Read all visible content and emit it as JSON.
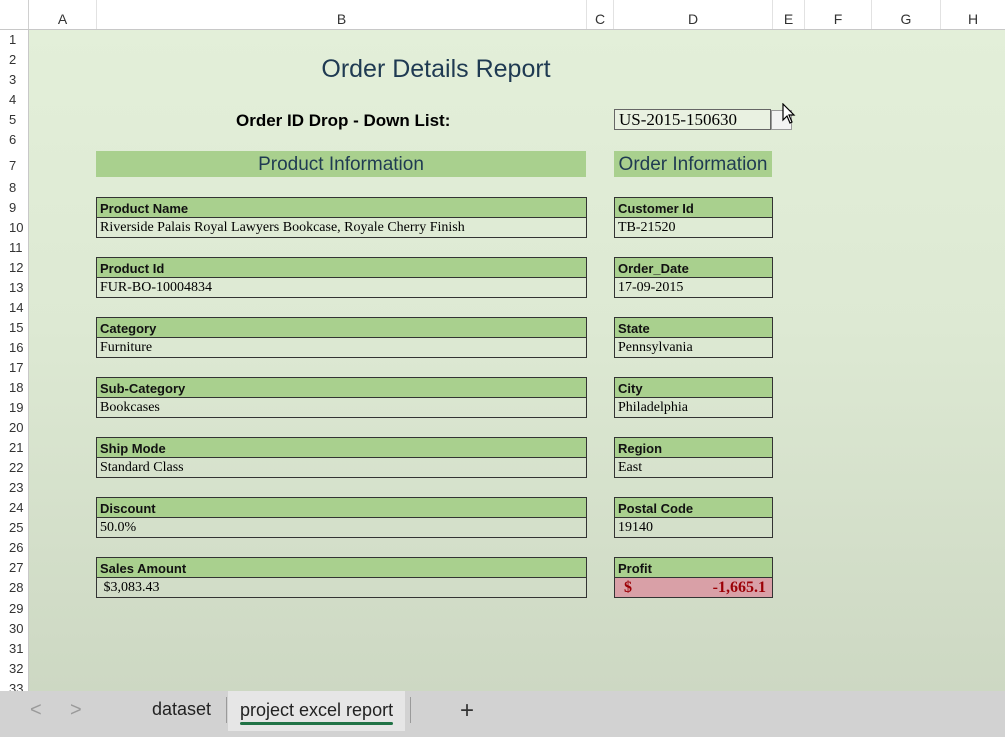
{
  "columns": [
    "A",
    "B",
    "C",
    "D",
    "E",
    "F",
    "G",
    "H"
  ],
  "rows": [
    "1",
    "2",
    "3",
    "4",
    "5",
    "6",
    "7",
    "8",
    "9",
    "10",
    "11",
    "12",
    "13",
    "14",
    "15",
    "16",
    "17",
    "18",
    "19",
    "20",
    "21",
    "22",
    "23",
    "24",
    "25",
    "26",
    "27",
    "28",
    "29",
    "30",
    "31",
    "32",
    "33"
  ],
  "report": {
    "title": "Order Details Report",
    "dropdown_label": "Order ID Drop - Down List:",
    "dropdown_value": "US-2015-150630"
  },
  "product_section": {
    "header": "Product Information",
    "fields": [
      {
        "label": "Product Name",
        "value": "Riverside Palais Royal Lawyers Bookcase, Royale Cherry Finish"
      },
      {
        "label": "Product Id",
        "value": "FUR-BO-10004834"
      },
      {
        "label": "Category",
        "value": "Furniture"
      },
      {
        "label": "Sub-Category",
        "value": "Bookcases"
      },
      {
        "label": "Ship Mode",
        "value": "Standard Class"
      },
      {
        "label": "Discount",
        "value": "50.0%"
      },
      {
        "label": "Sales Amount",
        "value": " $3,083.43"
      }
    ]
  },
  "order_section": {
    "header": "Order Information",
    "fields": [
      {
        "label": "Customer Id",
        "value": "TB-21520"
      },
      {
        "label": "Order_Date",
        "value": "17-09-2015"
      },
      {
        "label": "State",
        "value": "Pennsylvania"
      },
      {
        "label": "City",
        "value": "Philadelphia"
      },
      {
        "label": "Region",
        "value": "East"
      },
      {
        "label": "Postal Code",
        "value": "19140"
      }
    ],
    "profit": {
      "label": "Profit",
      "currency": "$",
      "amount": "-1,665.1"
    }
  },
  "sheet_tabs": {
    "prev": "<",
    "next": ">",
    "tabs": [
      "dataset",
      "project excel report"
    ],
    "active": "project excel report",
    "add": "+"
  },
  "colors": {
    "label_fill": "#a9d08e",
    "profit_fill": "#d9a0a7",
    "profit_text": "#9c0006",
    "active_tab_underline": "#217346"
  }
}
